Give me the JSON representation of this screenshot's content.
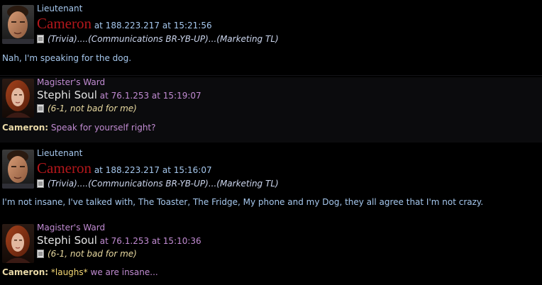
{
  "colors": {
    "background": "#000000",
    "cameron_rank": "#a6c8ee",
    "cameron_name": "#b3171b",
    "cameron_sub": "#ccd6ee",
    "cameron_body": "#a6c8ee",
    "stephi_rank": "#c18bd2",
    "stephi_name": "#e4e4e4",
    "stephi_info": "#c18bd2",
    "stephi_sub": "#e8d9a0",
    "stephi_body": "#c18bd2",
    "quote_name": "#e9d9a7",
    "laughs": "#f4d774"
  },
  "posts": [
    {
      "rank": "Lieutenant",
      "name": "Cameron",
      "info": "at 188.223.217 at 15:21:56",
      "sub": "(Trivia)....(Communications BR-YB-UP)...(Marketing TL)",
      "avatar_icon": "cameron-avatar",
      "body": "Nah, I'm speaking for the dog."
    },
    {
      "rank": "Magister's Ward",
      "name": "Stephi Soul",
      "info": "at 76.1.253 at 15:19:07",
      "sub": "(6-1, not bad for me)",
      "avatar_icon": "stephi-avatar",
      "quote_name": "Cameron:",
      "body": "Speak for yourself right?"
    },
    {
      "rank": "Lieutenant",
      "name": "Cameron",
      "info": "at 188.223.217 at 15:16:07",
      "sub": "(Trivia)....(Communications BR-YB-UP)...(Marketing TL)",
      "avatar_icon": "cameron-avatar",
      "body": "I'm not insane, I've talked with, The Toaster, The Fridge, My phone and my Dog, they all agree that I'm not crazy."
    },
    {
      "rank": "Magister's Ward",
      "name": "Stephi Soul",
      "info": "at 76.1.253 at 15:10:36",
      "sub": "(6-1, not bad for me)",
      "avatar_icon": "stephi-avatar",
      "quote_name": "Cameron:",
      "emote": "*laughs*",
      "body": "we are insane..."
    }
  ]
}
